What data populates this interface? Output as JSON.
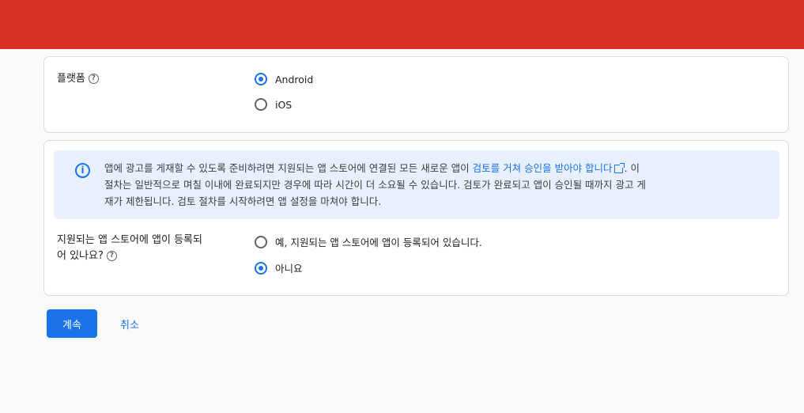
{
  "platform": {
    "label": "플랫폼",
    "help_icon": "help-circle-icon",
    "options": [
      {
        "label": "Android",
        "selected": true
      },
      {
        "label": "iOS",
        "selected": false
      }
    ]
  },
  "info": {
    "icon": "info-icon",
    "text_before_link": "앱에 광고를 게재할 수 있도록 준비하려면 지원되는 앱 스토어에 연결된 모든 새로운 앱이 ",
    "link": "검토를 거쳐 승인을 받아야 합니다",
    "external_icon": "open-in-new-icon",
    "text_line1_end": ". 이",
    "text_line2": "절차는 일반적으로 며칠 이내에 완료되지만 경우에 따라 시간이 더 소요될 수 있습니다. 검토가 완료되고 앱이 승인될 때까지 광고 게",
    "text_line3": "재가 제한됩니다. 검토 절차를 시작하려면 앱 설정을 마쳐야 합니다."
  },
  "store": {
    "label_line1": "지원되는 앱 스토어에 앱이 등록되",
    "label_line2": "어 있나요?",
    "help_icon": "help-circle-icon",
    "options": [
      {
        "label": "예, 지원되는 앱 스토어에 앱이 등록되어 있습니다.",
        "selected": false
      },
      {
        "label": "아니요",
        "selected": true
      }
    ]
  },
  "actions": {
    "continue_label": "계속",
    "cancel_label": "취소"
  },
  "colors": {
    "header": "#d93025",
    "accent": "#1a73e8",
    "info_bg": "#e8f0fe"
  }
}
